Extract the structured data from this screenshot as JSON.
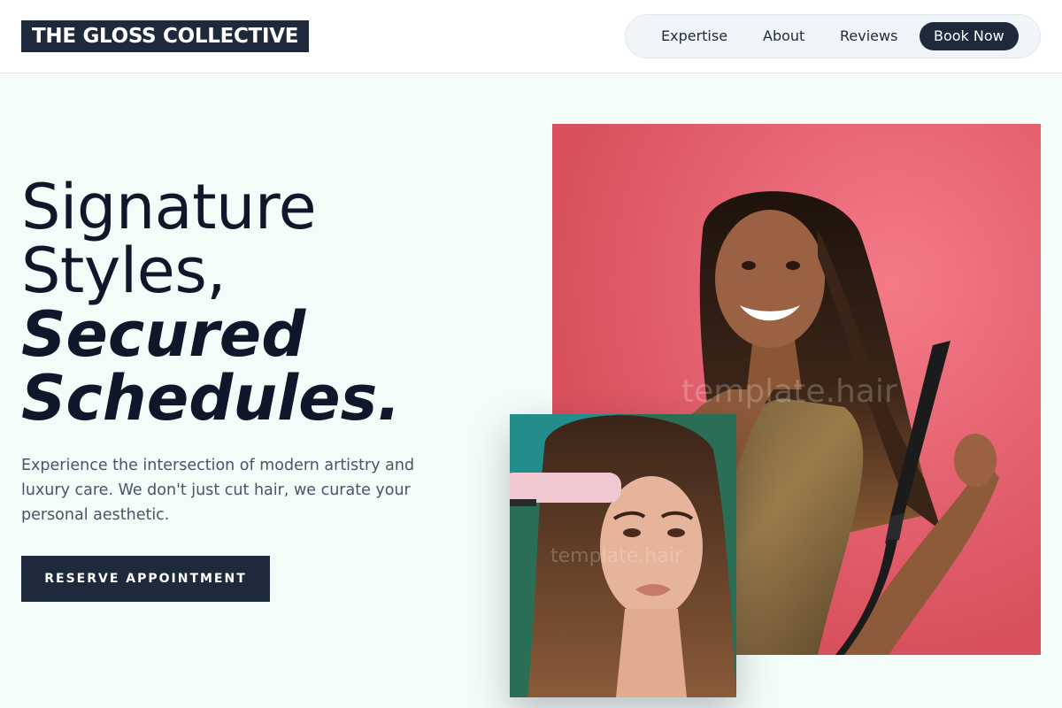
{
  "brand": {
    "logo_text": "THE GLOSS COLLECTIVE"
  },
  "nav": {
    "items": [
      {
        "label": "Expertise"
      },
      {
        "label": "About"
      },
      {
        "label": "Reviews"
      }
    ],
    "book_label": "Book Now"
  },
  "hero": {
    "headline_line1": "Signature",
    "headline_line2": "Styles,",
    "headline_line3": "Secured",
    "headline_line4": "Schedules.",
    "description": "Experience the intersection of modern artistry and luxury care. We don't just cut hair, we curate your personal aesthetic.",
    "cta_label": "RESERVE APPOINTMENT"
  },
  "images": {
    "main_watermark": "template.hair",
    "secondary_watermark": "template.hair"
  },
  "colors": {
    "primary_dark": "#1e293b",
    "background": "#f3fcf8",
    "photo_backdrop": "#e95c6b"
  }
}
